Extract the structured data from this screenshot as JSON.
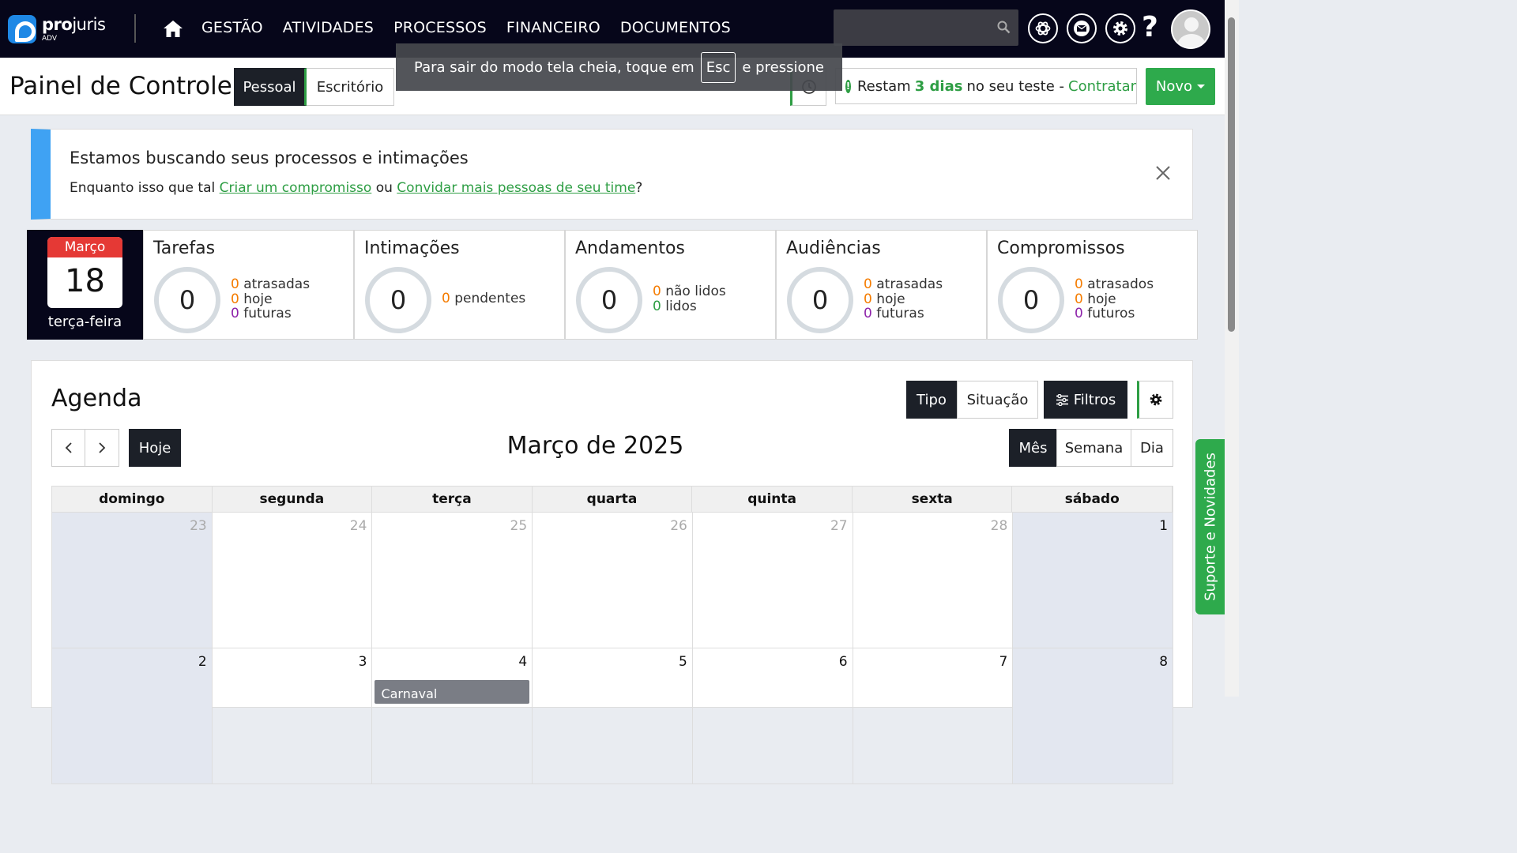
{
  "brand": {
    "name_bold": "pro",
    "name_light": "juris",
    "sub": "ADV"
  },
  "nav": {
    "links": [
      "GESTÃO",
      "ATIVIDADES",
      "PROCESSOS",
      "FINANCEIRO",
      "DOCUMENTOS"
    ]
  },
  "header": {
    "title": "Painel de Controle",
    "tab_pessoal": "Pessoal",
    "tab_escritorio": "Escritório",
    "trial_prefix": "Restam",
    "trial_days": "3 dias",
    "trial_suffix": "no seu teste -",
    "trial_link": "Contratar",
    "novo": "Novo"
  },
  "toast": {
    "before": "Para sair do modo tela cheia, toque em",
    "key": "Esc",
    "after": "e pressione"
  },
  "banner": {
    "title": "Estamos buscando seus processos e intimações",
    "text_before": "Enquanto isso que tal",
    "link1": "Criar um compromisso",
    "text_mid": "ou",
    "link2": "Convidar mais pessoas de seu time",
    "text_after": "?"
  },
  "date": {
    "month": "Março",
    "day": "18",
    "weekday": "terça-feira"
  },
  "stats": [
    {
      "title": "Tarefas",
      "total": "0",
      "lines": [
        {
          "n": "0",
          "label": "atrasadas",
          "color": "#f57c00"
        },
        {
          "n": "0",
          "label": "hoje",
          "color": "#f57c00"
        },
        {
          "n": "0",
          "label": "futuras",
          "color": "#8e24aa"
        }
      ]
    },
    {
      "title": "Intimações",
      "total": "0",
      "lines": [
        {
          "n": "0",
          "label": "pendentes",
          "color": "#f57c00"
        }
      ]
    },
    {
      "title": "Andamentos",
      "total": "0",
      "lines": [
        {
          "n": "0",
          "label": "não lidos",
          "color": "#f57c00"
        },
        {
          "n": "0",
          "label": "lidos",
          "color": "#2e9e44"
        }
      ]
    },
    {
      "title": "Audiências",
      "total": "0",
      "lines": [
        {
          "n": "0",
          "label": "atrasadas",
          "color": "#f57c00"
        },
        {
          "n": "0",
          "label": "hoje",
          "color": "#f57c00"
        },
        {
          "n": "0",
          "label": "futuras",
          "color": "#8e24aa"
        }
      ]
    },
    {
      "title": "Compromissos",
      "total": "0",
      "lines": [
        {
          "n": "0",
          "label": "atrasados",
          "color": "#f57c00"
        },
        {
          "n": "0",
          "label": "hoje",
          "color": "#f57c00"
        },
        {
          "n": "0",
          "label": "futuros",
          "color": "#8e24aa"
        }
      ]
    }
  ],
  "agenda": {
    "title": "Agenda",
    "tipo": "Tipo",
    "situacao": "Situação",
    "filtros": "Filtros",
    "hoje": "Hoje",
    "month_title": "Março de 2025",
    "view_mes": "Mês",
    "view_semana": "Semana",
    "view_dia": "Dia",
    "weekdays": [
      "domingo",
      "segunda",
      "terça",
      "quarta",
      "quinta",
      "sexta",
      "sábado"
    ],
    "weeks": [
      [
        {
          "d": "23",
          "muted": true
        },
        {
          "d": "24",
          "muted": true
        },
        {
          "d": "25",
          "muted": true
        },
        {
          "d": "26",
          "muted": true
        },
        {
          "d": "27",
          "muted": true
        },
        {
          "d": "28",
          "muted": true
        },
        {
          "d": "1",
          "muted": false
        }
      ],
      [
        {
          "d": "2",
          "muted": false
        },
        {
          "d": "3",
          "muted": false
        },
        {
          "d": "4",
          "muted": false,
          "event": "Carnaval"
        },
        {
          "d": "5",
          "muted": false
        },
        {
          "d": "6",
          "muted": false
        },
        {
          "d": "7",
          "muted": false
        },
        {
          "d": "8",
          "muted": false
        }
      ]
    ]
  },
  "side_tab": "Suporte e Novidades",
  "icons": [
    "home-icon",
    "search-icon",
    "openai-icon",
    "mail-icon",
    "gear-icon",
    "help-icon",
    "avatar",
    "history-icon",
    "close-icon",
    "chevron-left-icon",
    "chevron-right-icon",
    "filter-icon"
  ]
}
